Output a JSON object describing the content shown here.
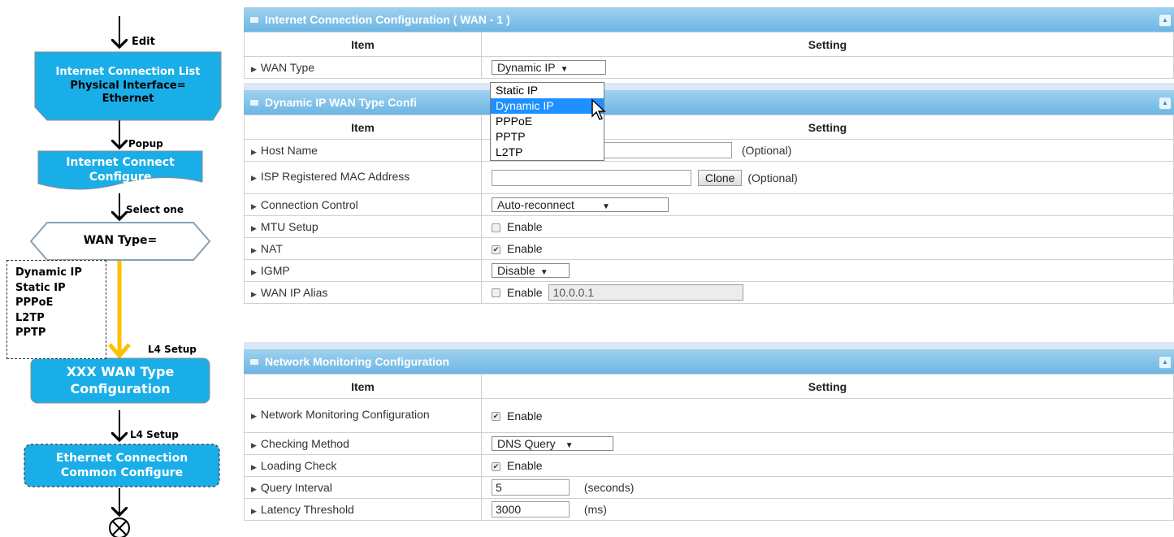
{
  "flowchart": {
    "edit_label": "Edit",
    "list_box": [
      "Internet Connection List",
      "Physical Interface=",
      "Ethernet"
    ],
    "popup_label": "Popup",
    "configure_box": [
      "Internet Connect",
      "Configure"
    ],
    "select_label": "Select one",
    "wan_type_box": "WAN Type=",
    "wan_options": [
      "Dynamic IP",
      "Static IP",
      "PPPoE",
      "L2TP",
      "PPTP"
    ],
    "l4_setup_label_1": "L4 Setup",
    "xxx_box": [
      "XXX WAN  Type",
      "Configuration"
    ],
    "l4_setup_label_2": "L4 Setup",
    "common_box": [
      "Ethernet Connection",
      "Common Configure"
    ],
    "colors": {
      "box": "#1aaee8",
      "arrow": "#ffc000"
    }
  },
  "panel1": {
    "title": "Internet Connection Configuration ( WAN - 1 )",
    "col_item": "Item",
    "col_setting": "Setting",
    "wan_type_label": "WAN Type",
    "wan_type_value": "Dynamic IP",
    "dropdown_options": [
      "Static IP",
      "Dynamic IP",
      "PPPoE",
      "PPTP",
      "L2TP"
    ]
  },
  "panel2": {
    "title": "Dynamic IP WAN Type Confi",
    "col_item": "Item",
    "col_setting": "Setting",
    "host_name_label": "Host Name",
    "host_name_hint": "(Optional)",
    "mac_label": "ISP Registered MAC Address",
    "clone_label": "Clone",
    "mac_hint": "(Optional)",
    "conn_control_label": "Connection Control",
    "conn_control_value": "Auto-reconnect",
    "mtu_label": "MTU Setup",
    "mtu_check": "Enable",
    "nat_label": "NAT",
    "nat_check": "Enable",
    "igmp_label": "IGMP",
    "igmp_value": "Disable",
    "alias_label": "WAN IP Alias",
    "alias_check": "Enable",
    "alias_value": "10.0.0.1"
  },
  "panel3": {
    "title": "Network Monitoring Configuration",
    "col_item": "Item",
    "col_setting": "Setting",
    "monitor_label": "Network Monitoring Configuration",
    "monitor_check": "Enable",
    "method_label": "Checking Method",
    "method_value": "DNS Query",
    "loading_label": "Loading Check",
    "loading_check": "Enable",
    "interval_label": "Query Interval",
    "interval_value": "5",
    "interval_unit": "(seconds)",
    "latency_label": "Latency Threshold",
    "latency_value": "3000",
    "latency_unit": "(ms)"
  }
}
